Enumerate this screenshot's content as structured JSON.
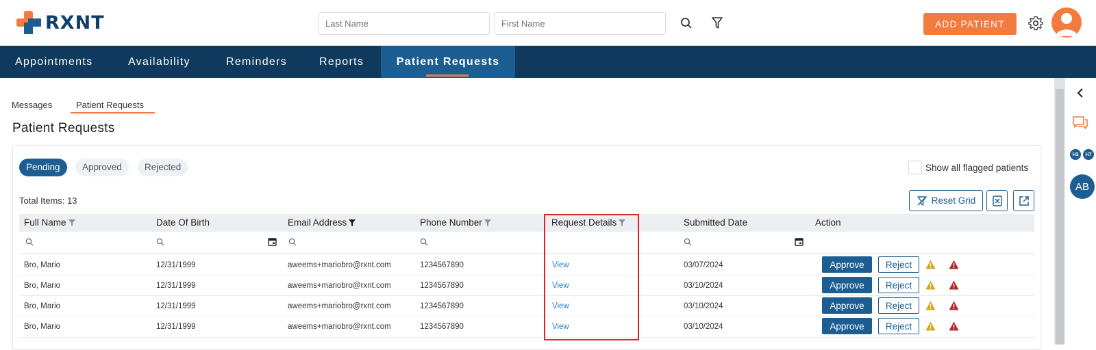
{
  "app": {
    "logo_text": "RXNT"
  },
  "header": {
    "last_name_placeholder": "Last Name",
    "first_name_placeholder": "First Name",
    "add_patient_label": "ADD PATIENT"
  },
  "nav": {
    "items": [
      {
        "label": "Appointments"
      },
      {
        "label": "Availability"
      },
      {
        "label": "Reminders"
      },
      {
        "label": "Reports"
      },
      {
        "label": "Patient Requests",
        "active": true
      }
    ]
  },
  "subtabs": [
    {
      "label": "Messages"
    },
    {
      "label": "Patient Requests",
      "active": true
    }
  ],
  "page_title": "Patient Requests",
  "status_tabs": [
    {
      "label": "Pending",
      "active": true
    },
    {
      "label": "Approved"
    },
    {
      "label": "Rejected"
    }
  ],
  "flag_label": "Show all flagged patients",
  "total_items": "Total Items: 13",
  "reset_grid_label": "Reset Grid",
  "table": {
    "columns": [
      "Full Name",
      "Date Of Birth",
      "Email Address",
      "Phone Number",
      "Request Details",
      "Submitted Date",
      "Action"
    ],
    "rows": [
      {
        "name": "Bro, Mario",
        "dob": "12/31/1999",
        "email": "aweems+mariobro@rxnt.com",
        "phone": "1234567890",
        "details": "View",
        "submitted": "03/07/2024"
      },
      {
        "name": "Bro, Mario",
        "dob": "12/31/1999",
        "email": "aweems+mariobro@rxnt.com",
        "phone": "1234567890",
        "details": "View",
        "submitted": "03/10/2024"
      },
      {
        "name": "Bro, Mario",
        "dob": "12/31/1999",
        "email": "aweems+mariobro@rxnt.com",
        "phone": "1234567890",
        "details": "View",
        "submitted": "03/10/2024"
      },
      {
        "name": "Bro, Mario",
        "dob": "12/31/1999",
        "email": "aweems+mariobro@rxnt.com",
        "phone": "1234567890",
        "details": "View",
        "submitted": "03/10/2024"
      }
    ],
    "approve_label": "Approve",
    "reject_label": "Reject"
  },
  "rail": {
    "mini_badges": [
      "H3",
      "H7"
    ],
    "avatar_initials": "AB"
  },
  "colors": {
    "brand_blue": "#0f3a5e",
    "active_blue": "#1c5e91",
    "accent_orange": "#f47b3f",
    "highlight_red": "#e01f26"
  },
  "icons": [
    "search-icon",
    "filter-icon",
    "gear-icon",
    "user-avatar-icon",
    "chevron-left-icon",
    "chat-icon",
    "calendar-icon",
    "warning-icon",
    "alert-icon",
    "export-icon",
    "excel-icon",
    "reset-filter-icon"
  ]
}
